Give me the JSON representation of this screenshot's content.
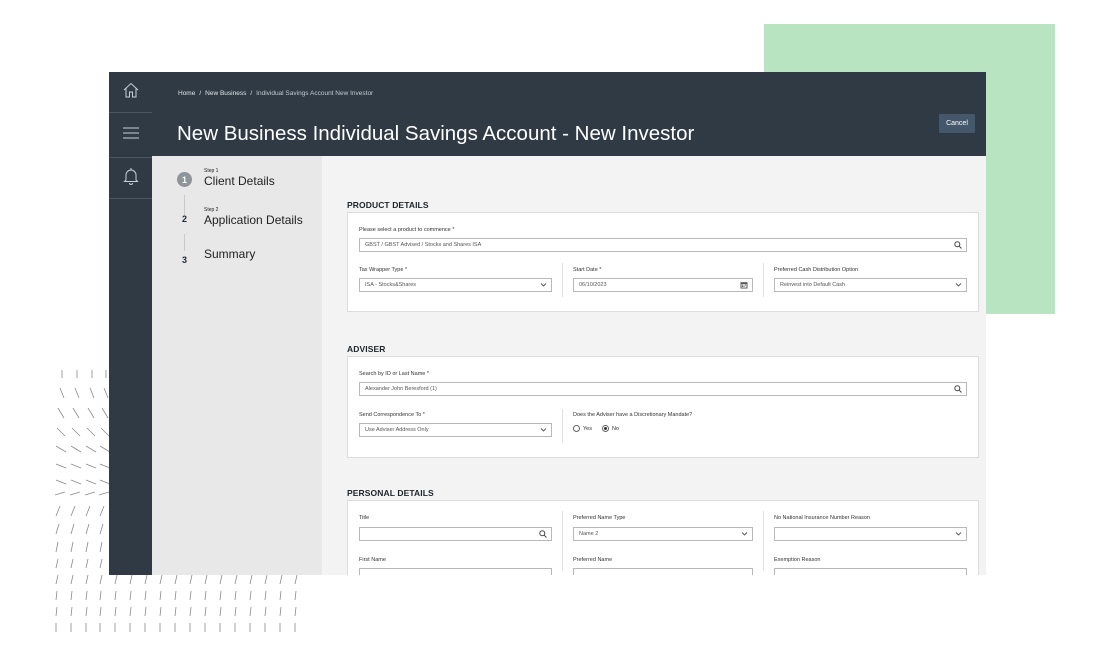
{
  "breadcrumb": [
    "Home",
    "New Business",
    "Individual Savings Account New Investor"
  ],
  "page_title": "New Business Individual Savings Account - New Investor",
  "cancel_label": "Cancel",
  "rail_icons": [
    "home-icon",
    "menu-icon",
    "bell-icon"
  ],
  "steps": [
    {
      "small": "Step 1",
      "label": "Client Details",
      "num": "1"
    },
    {
      "small": "Step 2",
      "label": "Application Details",
      "num": "2"
    },
    {
      "small": "",
      "label": "Summary",
      "num": "3"
    }
  ],
  "product": {
    "title": "PRODUCT DETAILS",
    "select_label": "Please select a product to commence *",
    "select_value": "GBST / GBST Advised / Stocks and Shares ISA",
    "tax_label": "Tax Wrapper Type *",
    "tax_value": "ISA - Stocks&Shares",
    "start_label": "Start Date *",
    "start_value": "06/10/2023",
    "cash_label": "Preferred Cash Distribution Option",
    "cash_value": "Reinvest into Default Cash"
  },
  "adviser": {
    "title": "ADVISER",
    "search_label": "Search by ID or Last Name *",
    "search_value": "Alexander John Beresford (1)",
    "corr_label": "Send Correspondence To *",
    "corr_value": "Use Adviser Address Only",
    "mandate_label": "Does the Adviser have a Discretionary Mandate?",
    "yes": "Yes",
    "no": "No",
    "mandate_value": "No"
  },
  "personal": {
    "title": "PERSONAL DETAILS",
    "title_label": "Title",
    "title_value": "",
    "pref_name_type_label": "Preferred Name Type",
    "pref_name_type_value": "Name 2",
    "nino_reason_label": "No National Insurance Number Reason",
    "nino_reason_value": "",
    "first_name_label": "First Name",
    "pref_name_label": "Preferred Name",
    "exemption_label": "Exemption Reason"
  },
  "colors": {
    "header": "#2f3a44",
    "accent_green": "#b9e4c2",
    "cancel_button": "#44576b"
  }
}
